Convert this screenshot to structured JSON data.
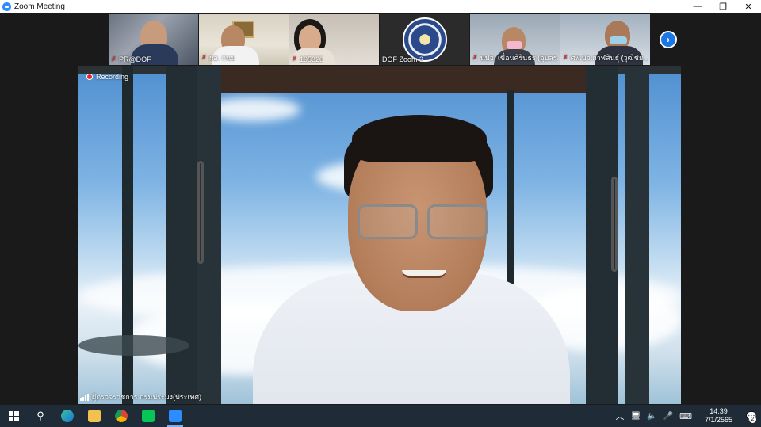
{
  "window": {
    "title": "Zoom Meeting",
    "minimize": "—",
    "restore": "❐",
    "close": "✕"
  },
  "thumbnails": [
    {
      "name": "PR@DOF",
      "muted": true
    },
    {
      "name": "ผอ. กนม",
      "muted": true
    },
    {
      "name": "195320",
      "muted": true
    },
    {
      "name": "DOF Zoom 3",
      "muted": false
    },
    {
      "name": "นปจ. เขื่อนศิรินธร (อุบลร...",
      "muted": true
    },
    {
      "name": "ศพ.ปจ.กาฬสินธุ์ (วุฒิชัย...",
      "muted": true
    }
  ],
  "main_video": {
    "recording_label": "Recording",
    "speaker_name": "ผู้ตรวจราชการ กรมประมง(ประเทศ)"
  },
  "icons": {
    "next": "›",
    "mic_off": "✗",
    "search": "⚲",
    "tray_chevron": "︿",
    "mic": "🎤",
    "volume": "🔈",
    "keyboard": "⌨",
    "network": "🖥",
    "notification": "💬"
  },
  "taskbar": {
    "time": "14:39",
    "date": "7/1/2565",
    "notification_count": "2"
  },
  "colors": {
    "accent": "#1c77e6",
    "recording": "#e02828",
    "taskbar": "#1f2b37"
  }
}
